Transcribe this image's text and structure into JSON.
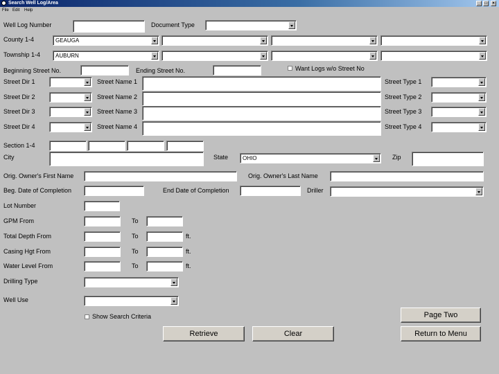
{
  "window": {
    "title": "Search Well Log/Area"
  },
  "menu": [
    "File",
    "Edit",
    "Help"
  ],
  "labels": {
    "well_log_number": "Well Log Number",
    "document_type": "Document Type",
    "county": "County 1-4",
    "township": "Township 1-4",
    "beginning_street_no": "Beginning Street No.",
    "ending_street_no": "Ending Street No.",
    "want_logs": "Want Logs w/o Street No",
    "street_dir": [
      "Street Dir 1",
      "Street Dir 2",
      "Street Dir 3",
      "Street Dir 4"
    ],
    "street_name": [
      "Street Name 1",
      "Street Name 2",
      "Street Name 3",
      "Street Name 4"
    ],
    "street_type": [
      "Street Type 1",
      "Street Type 2",
      "Street Type 3",
      "Street Type 4"
    ],
    "section": "Section 1-4",
    "city": "City",
    "state": "State",
    "zip": "Zip",
    "orig_first": "Orig. Owner's First Name",
    "orig_last": "Orig. Owner's Last Name",
    "beg_date": "Beg. Date of Completion",
    "end_date": "End Date of Completion",
    "driller": "Driller",
    "lot_number": "Lot Number",
    "gpm_from": "GPM From",
    "total_depth_from": "Total Depth From",
    "casing_hgt_from": "Casing Hgt From",
    "water_level_from": "Water Level From",
    "to": "To",
    "ft": "ft.",
    "drilling_type": "Drilling Type",
    "well_use": "Well Use",
    "show_search": "Show Search Criteria"
  },
  "values": {
    "county1": "GEAUGA",
    "township1": "AUBURN",
    "state": "OHIO"
  },
  "buttons": {
    "page_two": "Page Two",
    "retrieve": "Retrieve",
    "clear": "Clear",
    "return_menu": "Return to Menu"
  }
}
